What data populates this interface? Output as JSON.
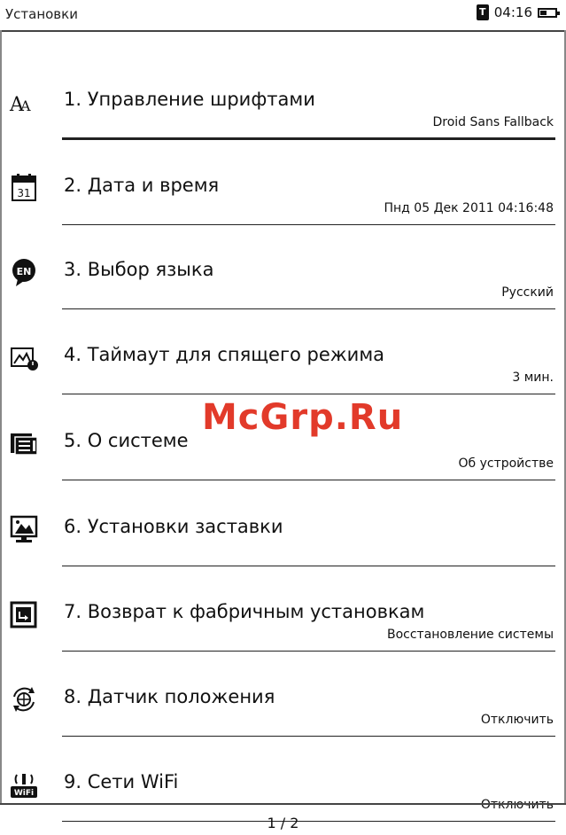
{
  "statusbar": {
    "title": "Установки",
    "time": "04:16",
    "book_icon": "book-icon",
    "battery_icon": "battery-icon"
  },
  "items": [
    {
      "label": "1. Управление шрифтами",
      "value": "Droid Sans Fallback",
      "icon": "font-icon"
    },
    {
      "label": "2. Дата и время",
      "value": "Пнд 05 Дек 2011 04:16:48",
      "icon": "calendar-icon",
      "icon_text": "31"
    },
    {
      "label": "3. Выбор языка",
      "value": "Русский",
      "icon": "language-icon",
      "icon_text": "EN"
    },
    {
      "label": "4. Таймаут для спящего режима",
      "value": "3 мин.",
      "icon": "sleep-timeout-icon"
    },
    {
      "label": "5. О системе",
      "value": "Об устройстве",
      "icon": "system-info-icon"
    },
    {
      "label": "6. Установки заставки",
      "value": "",
      "icon": "screensaver-icon"
    },
    {
      "label": "7. Возврат к фабричным установкам",
      "value": "Восстановление системы",
      "icon": "factory-reset-icon"
    },
    {
      "label": "8. Датчик положения",
      "value": "Отключить",
      "icon": "orientation-sensor-icon"
    },
    {
      "label": "9. Сети WiFi",
      "value": "Отключить",
      "icon": "wifi-icon",
      "icon_text": "WiFi"
    }
  ],
  "footer": {
    "pager": "1 / 2"
  },
  "watermark": "McGrp.Ru"
}
